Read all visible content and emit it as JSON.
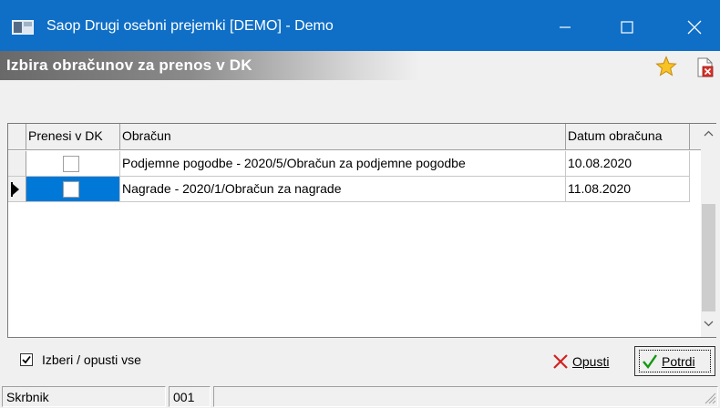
{
  "window": {
    "title": "Saop Drugi osebni prejemki  [DEMO] - Demo",
    "accent": "#0f6fc6"
  },
  "header": {
    "title": "Izbira obračunov za prenos v DK",
    "icons": [
      "star-icon",
      "delete-document-icon"
    ]
  },
  "grid": {
    "columns": [
      "Prenesi v DK",
      "Obračun",
      "Datum obračuna"
    ],
    "rows": [
      {
        "checked": false,
        "obracun": "Podjemne pogodbe - 2020/5/Obračun za podjemne pogodbe",
        "datum": "10.08.2020",
        "current": false
      },
      {
        "checked": false,
        "obracun": "Nagrade - 2020/1/Obračun za nagrade",
        "datum": "11.08.2020",
        "current": true
      }
    ],
    "selection_color": "#0078d7"
  },
  "footer": {
    "select_all_label": "Izberi / opusti vse",
    "select_all_checked": true,
    "cancel_label": "Opusti",
    "ok_label": "Potrdi"
  },
  "status": {
    "user": "Skrbnik",
    "code": "001",
    "message": ""
  }
}
